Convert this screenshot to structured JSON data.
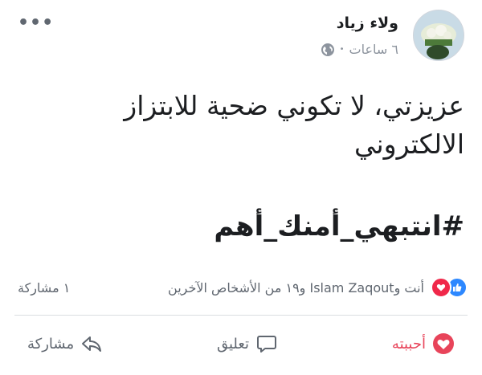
{
  "post": {
    "author": "ولاء زياد",
    "time": "٦ ساعات",
    "meta_separator": "•",
    "more_label": "•••",
    "body_text": "عزيزتي، لا تكوني ضحية للابتزاز الالكتروني",
    "hashtag": "#انتبهي_أمنك_أهم"
  },
  "reactions": {
    "summary": "أنت وIslam Zaqout و١٩ من الأشخاص الآخرين",
    "shares": "١ مشاركة"
  },
  "actions": {
    "love_label": "أحببته",
    "comment_label": "تعليق",
    "share_label": "مشاركة"
  },
  "colors": {
    "love": "#e8445a",
    "like": "#2d88ff",
    "muted": "#606770"
  },
  "icons": {
    "privacy": "globe-icon",
    "like": "thumbs-up-icon",
    "love": "heart-icon",
    "comment": "comment-icon",
    "share": "share-arrow-icon",
    "more": "more-dots-icon"
  }
}
